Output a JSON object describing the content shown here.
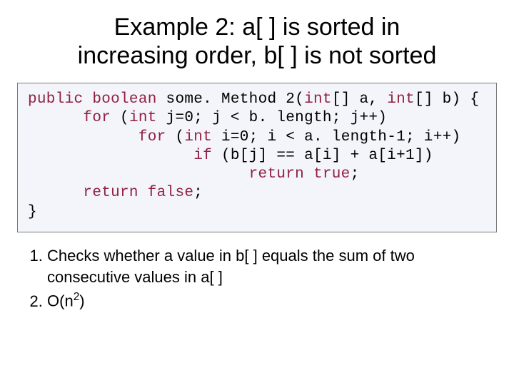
{
  "title_line1": "Example 2: a[ ] is sorted in",
  "title_line2": "increasing order, b[ ] is not sorted",
  "code": {
    "l1a": "public",
    "l1b": " ",
    "l1c": "boolean",
    "l1d": " some. Method 2(",
    "l1e": "int",
    "l1f": "[] a, ",
    "l1g": "int",
    "l1h": "[] b) {",
    "l2a": "      for",
    "l2b": " (",
    "l2c": "int",
    "l2d": " j=0; j < b. length; j++)",
    "l3a": "            for",
    "l3b": " (",
    "l3c": "int",
    "l3d": " i=0; i < a. length-1; i++)",
    "l4a": "                  if",
    "l4b": " (b[j] == a[i] + a[i+1])",
    "l5a": "                        return",
    "l5b": " ",
    "l5c": "true",
    "l5d": ";",
    "l6a": "      return",
    "l6b": " ",
    "l6c": "false",
    "l6d": ";",
    "l7": "}"
  },
  "list": {
    "item1_line1": "Checks whether a value in b[ ] equals the sum of two",
    "item1_line2": "consecutive values in a[ ]",
    "item2_pre": "O(n",
    "item2_sup": "2",
    "item2_post": ")"
  }
}
